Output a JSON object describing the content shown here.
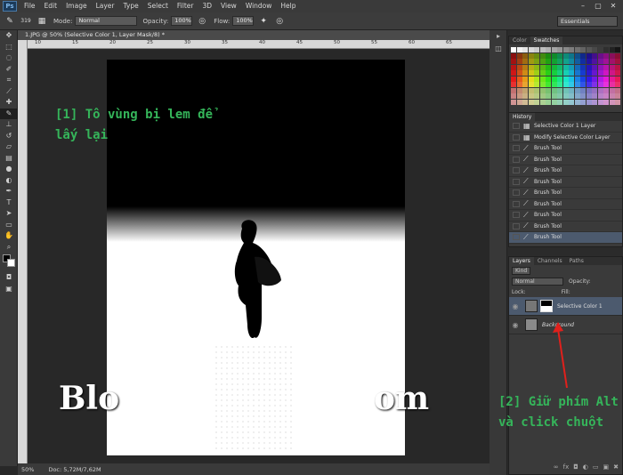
{
  "app": {
    "logo": "Ps",
    "menu": [
      "File",
      "Edit",
      "Image",
      "Layer",
      "Type",
      "Select",
      "Filter",
      "3D",
      "View",
      "Window",
      "Help"
    ],
    "window_controls": [
      "–",
      "▢",
      "✕"
    ]
  },
  "options": {
    "brush_size": "319",
    "mode_label": "Mode:",
    "mode_value": "Normal",
    "opacity_label": "Opacity:",
    "opacity_value": "100%",
    "flow_label": "Flow:",
    "flow_value": "100%",
    "workspace": "Essentials"
  },
  "document": {
    "tab_title": "1.JPG @ 50% (Selective Color 1, Layer Mask/8) *",
    "ruler_ticks": [
      "10",
      "15",
      "20",
      "25",
      "30",
      "35",
      "40",
      "45",
      "50",
      "55",
      "60",
      "65"
    ],
    "zoom": "50%",
    "doc_size": "Doc: 5,72M/7,62M"
  },
  "annotations": {
    "step1_line1": "[1] Tô vùng bị lem để",
    "step1_line2": "lấy lại",
    "step2_line1": "[2] Giữ phím Alt",
    "step2_line2": "và click chuột",
    "watermark_head": "Blo",
    "watermark_tail": "om"
  },
  "panels": {
    "color_tabs": [
      "Color",
      "Swatches"
    ],
    "history": {
      "title": "History",
      "items": [
        {
          "label": "Selective Color 1 Layer",
          "icon": "layer-icon"
        },
        {
          "label": "Modify Selective Color Layer",
          "icon": "layer-icon"
        },
        {
          "label": "Brush Tool",
          "icon": "brush-icon"
        },
        {
          "label": "Brush Tool",
          "icon": "brush-icon"
        },
        {
          "label": "Brush Tool",
          "icon": "brush-icon"
        },
        {
          "label": "Brush Tool",
          "icon": "brush-icon"
        },
        {
          "label": "Brush Tool",
          "icon": "brush-icon"
        },
        {
          "label": "Brush Tool",
          "icon": "brush-icon"
        },
        {
          "label": "Brush Tool",
          "icon": "brush-icon"
        },
        {
          "label": "Brush Tool",
          "icon": "brush-icon"
        },
        {
          "label": "Brush Tool",
          "icon": "brush-icon"
        }
      ]
    },
    "layers": {
      "tabs": [
        "Layers",
        "Channels",
        "Paths"
      ],
      "kind_label": "Kind",
      "blend": "Normal",
      "opacity_label": "Opacity:",
      "lock_label": "Lock:",
      "fill_label": "Fill:",
      "items": [
        {
          "name": "Selective Color 1"
        },
        {
          "name": "Background"
        }
      ]
    }
  },
  "colors": {
    "annotation": "#35b55a",
    "arrow": "#e0201c",
    "selection": "#4c5a6e"
  }
}
